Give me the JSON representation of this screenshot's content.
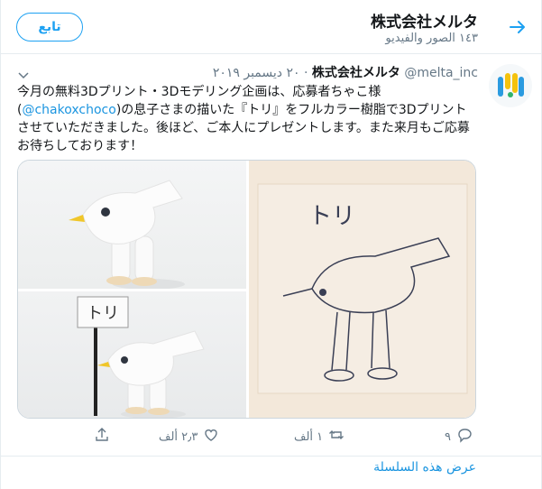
{
  "header": {
    "title": "株式会社メルタ",
    "subtitle": "١٤٣ الصور والفيديو",
    "follow_label": "تابع"
  },
  "tweet": {
    "author_name": "株式会社メルタ",
    "author_handle": "@melta_inc",
    "separator": "·",
    "date": "٢٠ ديسمبر ٢٠١٩",
    "text_part1": "今月の無料3Dプリント・3Dモデリング企画は、応募者ちゃこ様(",
    "mention": "@chakoxchoco",
    "text_part2": ")の息子さまの描いた『トリ』をフルカラー樹脂で3Dプリントさせていただきました。後ほど、ご本人にプレゼントします。また来月もご応募お待ちしております！",
    "media_sign_text": "トリ",
    "drawing_text": "トリ",
    "actions": {
      "reply_count": "٩",
      "retweet_count": "١ ألف",
      "like_count": "٢٫٣ ألف"
    }
  },
  "show_thread": "عرض هذه السلسلة",
  "colors": {
    "accent": "#1da1f2",
    "link": "#1b95e0",
    "muted": "#657786",
    "border": "#e6ecf0"
  },
  "icons": {
    "back": "arrow-right-icon",
    "caret": "chevron-down-icon",
    "reply": "reply-icon",
    "retweet": "retweet-icon",
    "like": "heart-icon",
    "share": "share-icon"
  }
}
